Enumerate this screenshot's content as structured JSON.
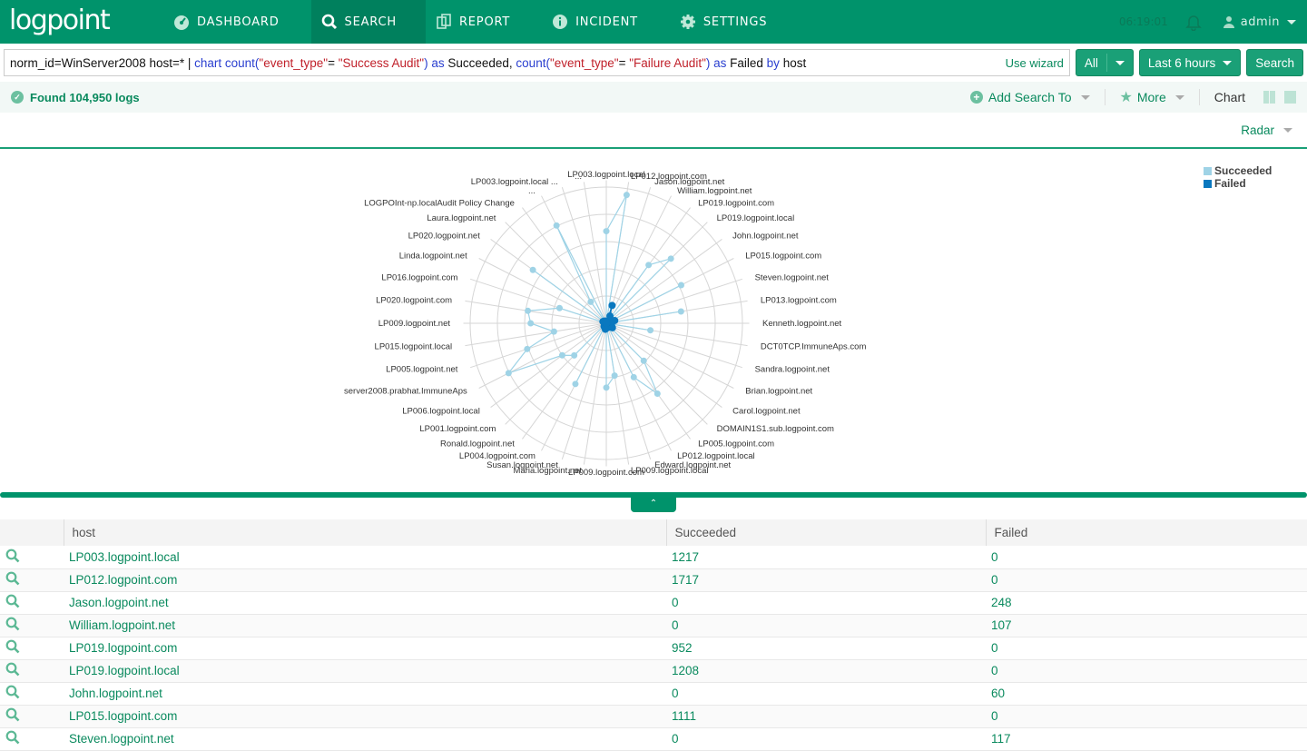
{
  "app": {
    "logo": "logpoint",
    "nav": [
      {
        "label": "DASHBOARD",
        "icon": "dashboard-icon",
        "active": false
      },
      {
        "label": "SEARCH",
        "icon": "search-icon",
        "active": true
      },
      {
        "label": "REPORT",
        "icon": "report-icon",
        "active": false
      },
      {
        "label": "INCIDENT",
        "icon": "info-icon",
        "active": false
      },
      {
        "label": "SETTINGS",
        "icon": "gear-icon",
        "active": false
      }
    ],
    "clock": "06:19:01",
    "user": "admin"
  },
  "search": {
    "query_tokens": [
      {
        "t": "norm_id=WinServer2008 host=* | ",
        "c": "plain"
      },
      {
        "t": "chart count(",
        "c": "kw"
      },
      {
        "t": "\"event_type\"",
        "c": "str"
      },
      {
        "t": "= ",
        "c": "plain"
      },
      {
        "t": "\"Success Audit\"",
        "c": "str"
      },
      {
        "t": ") as ",
        "c": "kw"
      },
      {
        "t": "Succeeded,  ",
        "c": "plain"
      },
      {
        "t": "count(",
        "c": "kw"
      },
      {
        "t": "\"event_type\"",
        "c": "str"
      },
      {
        "t": "= ",
        "c": "plain"
      },
      {
        "t": "\"Failure Audit\"",
        "c": "str"
      },
      {
        "t": ") as ",
        "c": "kw"
      },
      {
        "t": "Failed ",
        "c": "plain"
      },
      {
        "t": "by ",
        "c": "kw"
      },
      {
        "t": "host",
        "c": "plain"
      }
    ],
    "use_wizard": "Use wizard",
    "scope": "All",
    "time_range": "Last 6 hours",
    "search_button": "Search"
  },
  "status": {
    "found": "Found 104,950 logs",
    "add_search_to": "Add Search To",
    "more": "More",
    "chart_label": "Chart"
  },
  "chart_type": "Radar",
  "chart_data": {
    "type": "radar",
    "series": [
      {
        "name": "Succeeded",
        "color": "#9fd3e6"
      },
      {
        "name": "Failed",
        "color": "#0a78bf"
      }
    ],
    "max": 1800,
    "categories": [
      {
        "host": "LP003.logpoint.local",
        "succeeded": 1217,
        "failed": 0
      },
      {
        "host": "LP012.logpoint.com",
        "succeeded": 1717,
        "failed": 0
      },
      {
        "host": "Jason.logpoint.net",
        "succeeded": 0,
        "failed": 248
      },
      {
        "host": "William.logpoint.net",
        "succeeded": 0,
        "failed": 107
      },
      {
        "host": "LP019.logpoint.com",
        "succeeded": 952,
        "failed": 0
      },
      {
        "host": "LP019.logpoint.local",
        "succeeded": 1208,
        "failed": 0
      },
      {
        "host": "John.logpoint.net",
        "succeeded": 0,
        "failed": 60
      },
      {
        "host": "LP015.logpoint.com",
        "succeeded": 1111,
        "failed": 0
      },
      {
        "host": "Steven.logpoint.net",
        "succeeded": 0,
        "failed": 117
      },
      {
        "host": "LP013.logpoint.com",
        "succeeded": 1000,
        "failed": 0
      },
      {
        "host": "Kenneth.logpoint.net",
        "succeeded": 0,
        "failed": 60
      },
      {
        "host": "DCT0TCP.ImmuneAps.com",
        "succeeded": 590,
        "failed": 0
      },
      {
        "host": "Sandra.logpoint.net",
        "succeeded": 0,
        "failed": 70
      },
      {
        "host": "Brian.logpoint.net",
        "succeeded": 0,
        "failed": 80
      },
      {
        "host": "Carol.logpoint.net",
        "succeeded": 0,
        "failed": 100
      },
      {
        "host": "DOMAIN1S1.sub.logpoint.com",
        "succeeded": 700,
        "failed": 0
      },
      {
        "host": "LP005.logpoint.com",
        "succeeded": 1150,
        "failed": 0
      },
      {
        "host": "LP012.logpoint.local",
        "succeeded": 800,
        "failed": 0
      },
      {
        "host": "Edward.logpoint.net",
        "succeeded": 0,
        "failed": 60
      },
      {
        "host": "LP009.logpoint.local",
        "succeeded": 700,
        "failed": 0
      },
      {
        "host": "LP009.logpoint.com",
        "succeeded": 850,
        "failed": 0
      },
      {
        "host": "Maria.logpoint.net",
        "succeeded": 0,
        "failed": 80
      },
      {
        "host": "Susan.logpoint.net",
        "succeeded": 0,
        "failed": 60
      },
      {
        "host": "LP004.logpoint.com",
        "succeeded": 900,
        "failed": 0
      },
      {
        "host": "Ronald.logpoint.net",
        "succeeded": 0,
        "failed": 50
      },
      {
        "host": "LP001.logpoint.com",
        "succeeded": 600,
        "failed": 0
      },
      {
        "host": "LP006.logpoint.local",
        "succeeded": 720,
        "failed": 0
      },
      {
        "host": "server2008.prabhat.ImmuneAps",
        "succeeded": 1450,
        "failed": 0
      },
      {
        "host": "LP005.logpoint.net",
        "succeeded": 1100,
        "failed": 0
      },
      {
        "host": "LP015.logpoint.local",
        "succeeded": 700,
        "failed": 0
      },
      {
        "host": "LP009.logpoint.net",
        "succeeded": 1000,
        "failed": 0
      },
      {
        "host": "LP020.logpoint.com",
        "succeeded": 1050,
        "failed": 0
      },
      {
        "host": "LP016.logpoint.com",
        "succeeded": 650,
        "failed": 0
      },
      {
        "host": "Linda.logpoint.net",
        "succeeded": 0,
        "failed": 50
      },
      {
        "host": "LP020.logpoint.net",
        "succeeded": 1200,
        "failed": 0
      },
      {
        "host": "Laura.logpoint.net",
        "succeeded": 0,
        "failed": 40
      },
      {
        "host": "LOGPOInt-np.localAudit Policy Change",
        "succeeded": 350,
        "failed": 0
      },
      {
        "host": "...",
        "succeeded": 1450,
        "failed": 0
      },
      {
        "host": "LP003.logpoint.local ...",
        "succeeded": 0,
        "failed": 30
      },
      {
        "host": "...",
        "succeeded": 0,
        "failed": 20
      }
    ]
  },
  "table": {
    "columns": [
      "host",
      "Succeeded",
      "Failed"
    ],
    "rows": [
      {
        "host": "LP003.logpoint.local",
        "succeeded": "1217",
        "failed": "0"
      },
      {
        "host": "LP012.logpoint.com",
        "succeeded": "1717",
        "failed": "0"
      },
      {
        "host": "Jason.logpoint.net",
        "succeeded": "0",
        "failed": "248"
      },
      {
        "host": "William.logpoint.net",
        "succeeded": "0",
        "failed": "107"
      },
      {
        "host": "LP019.logpoint.com",
        "succeeded": "952",
        "failed": "0"
      },
      {
        "host": "LP019.logpoint.local",
        "succeeded": "1208",
        "failed": "0"
      },
      {
        "host": "John.logpoint.net",
        "succeeded": "0",
        "failed": "60"
      },
      {
        "host": "LP015.logpoint.com",
        "succeeded": "1111",
        "failed": "0"
      },
      {
        "host": "Steven.logpoint.net",
        "succeeded": "0",
        "failed": "117"
      }
    ]
  }
}
